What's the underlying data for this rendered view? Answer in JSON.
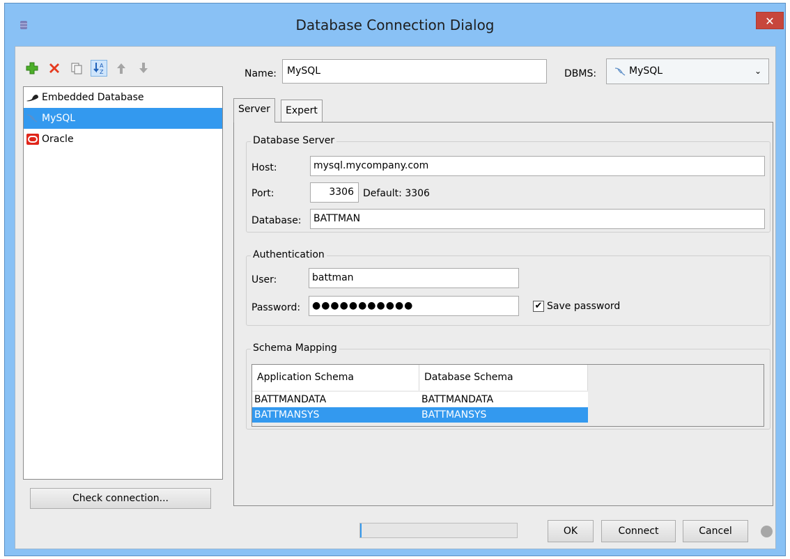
{
  "window": {
    "title": "Database Connection Dialog",
    "close_glyph": "✕"
  },
  "toolbar": {
    "icons": [
      "add-icon",
      "delete-icon",
      "copy-icon",
      "sort-icon",
      "move-up-icon",
      "move-down-icon"
    ]
  },
  "connections": [
    {
      "label": "Embedded Database",
      "icon": "hat-icon",
      "selected": false
    },
    {
      "label": "MySQL",
      "icon": "mysql-dolphin-icon",
      "selected": true
    },
    {
      "label": "Oracle",
      "icon": "oracle-icon",
      "selected": false
    }
  ],
  "check_connection_label": "Check connection...",
  "name": {
    "label": "Name:",
    "value": "MySQL"
  },
  "dbms": {
    "label": "DBMS:",
    "value": "MySQL"
  },
  "tabs": [
    {
      "label": "Server",
      "active": true
    },
    {
      "label": "Expert",
      "active": false
    }
  ],
  "database_server": {
    "title": "Database Server",
    "host_label": "Host:",
    "host_value": "mysql.mycompany.com",
    "port_label": "Port:",
    "port_value": "3306",
    "port_default": "Default: 3306",
    "database_label": "Database:",
    "database_value": "BATTMAN"
  },
  "authentication": {
    "title": "Authentication",
    "user_label": "User:",
    "user_value": "battman",
    "password_label": "Password:",
    "password_value": "●●●●●●●●●●●",
    "save_password_label": "Save password",
    "save_password_checked": true
  },
  "schema_mapping": {
    "title": "Schema Mapping",
    "columns": [
      "Application Schema",
      "Database Schema"
    ],
    "rows": [
      {
        "app": "BATTMANDATA",
        "db": "BATTMANDATA",
        "selected": false
      },
      {
        "app": "BATTMANSYS",
        "db": "BATTMANSYS",
        "selected": true
      }
    ]
  },
  "progress_fraction": 0.01,
  "buttons": {
    "ok": "OK",
    "connect": "Connect",
    "cancel": "Cancel"
  },
  "colors": {
    "titlebar": "#89c1f5",
    "selection": "#3399ef",
    "close": "#c7463c"
  }
}
